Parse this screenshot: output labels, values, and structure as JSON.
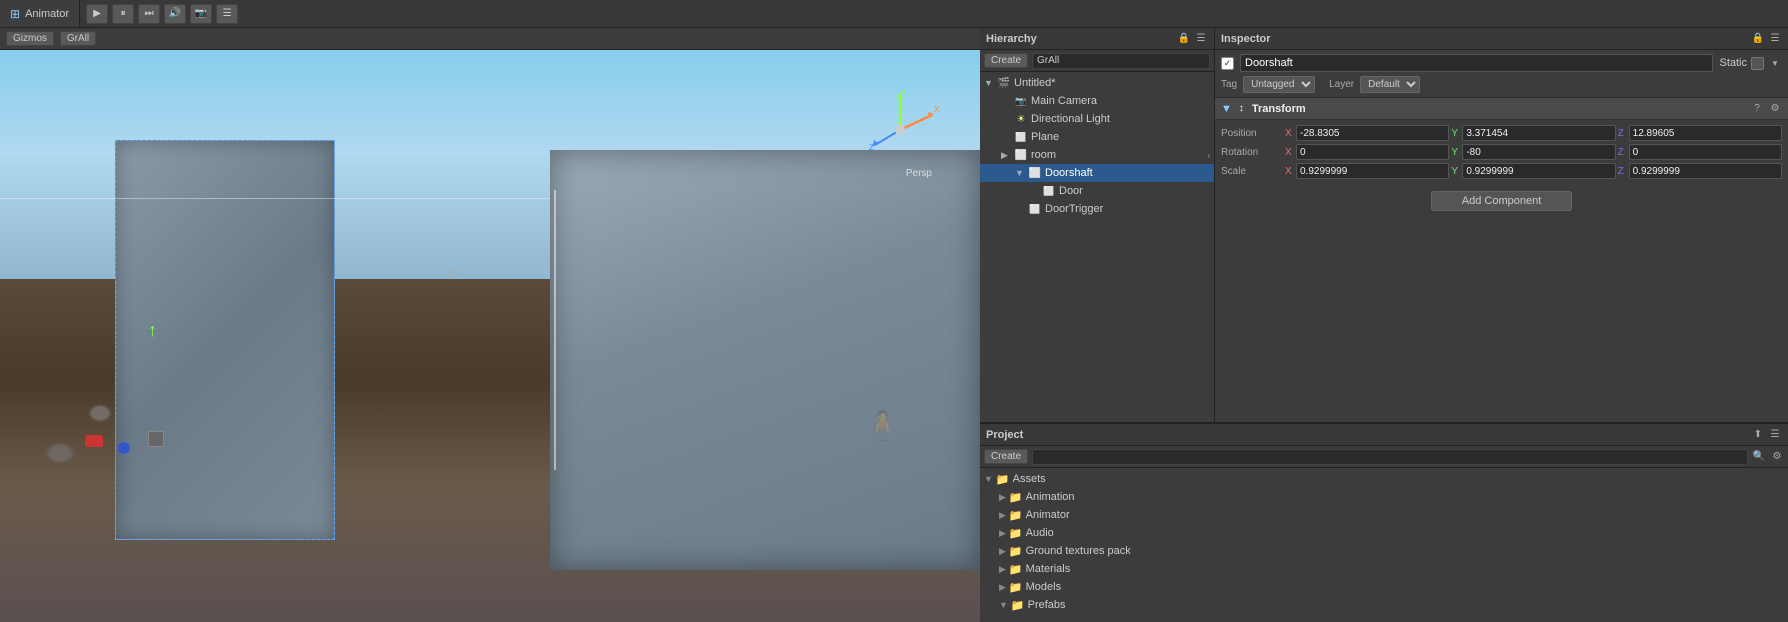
{
  "animator": {
    "title": "Animator"
  },
  "scene": {
    "gizmos_label": "Gizmos",
    "all_label": "GrAll",
    "persp_label": "Persp"
  },
  "hierarchy": {
    "title": "Hierarchy",
    "create_btn": "Create",
    "search_placeholder": "GrAll",
    "untitled_label": "Untitled*",
    "items": [
      {
        "label": "Main Camera",
        "indent": 1,
        "type": "camera",
        "expanded": false
      },
      {
        "label": "Directional Light",
        "indent": 1,
        "type": "light",
        "expanded": false
      },
      {
        "label": "Plane",
        "indent": 1,
        "type": "mesh",
        "expanded": false
      },
      {
        "label": "room",
        "indent": 1,
        "type": "folder",
        "expanded": true,
        "has_arrow": true
      },
      {
        "label": "Doorshaft",
        "indent": 2,
        "type": "folder",
        "expanded": true,
        "selected": true
      },
      {
        "label": "Door",
        "indent": 3,
        "type": "mesh",
        "expanded": false
      },
      {
        "label": "DoorTrigger",
        "indent": 2,
        "type": "mesh",
        "expanded": false
      }
    ]
  },
  "inspector": {
    "title": "Inspector",
    "object_name": "Doorshaft",
    "static_label": "Static",
    "tag_label": "Tag",
    "tag_value": "Untagged",
    "layer_label": "Layer",
    "layer_value": "Default",
    "transform_title": "Transform",
    "position_label": "Position",
    "rotation_label": "Rotation",
    "scale_label": "Scale",
    "pos_x": "-28.8305",
    "pos_y": "3.371454",
    "pos_z": "12.89605",
    "rot_x": "0",
    "rot_y": "-80",
    "rot_z": "0",
    "scale_x": "0.9299999",
    "scale_y": "0.9299999",
    "scale_z": "0.9299999",
    "add_component_label": "Add Component"
  },
  "project": {
    "title": "Project",
    "create_btn": "Create",
    "search_placeholder": "",
    "assets_label": "Assets",
    "items": [
      {
        "label": "Animation",
        "indent": 1,
        "expanded": false
      },
      {
        "label": "Animator",
        "indent": 1,
        "expanded": false
      },
      {
        "label": "Audio",
        "indent": 1,
        "expanded": false
      },
      {
        "label": "Ground textures pack",
        "indent": 1,
        "expanded": false
      },
      {
        "label": "Materials",
        "indent": 1,
        "expanded": false
      },
      {
        "label": "Models",
        "indent": 1,
        "expanded": false
      },
      {
        "label": "Prefabs",
        "indent": 1,
        "expanded": false
      }
    ]
  }
}
